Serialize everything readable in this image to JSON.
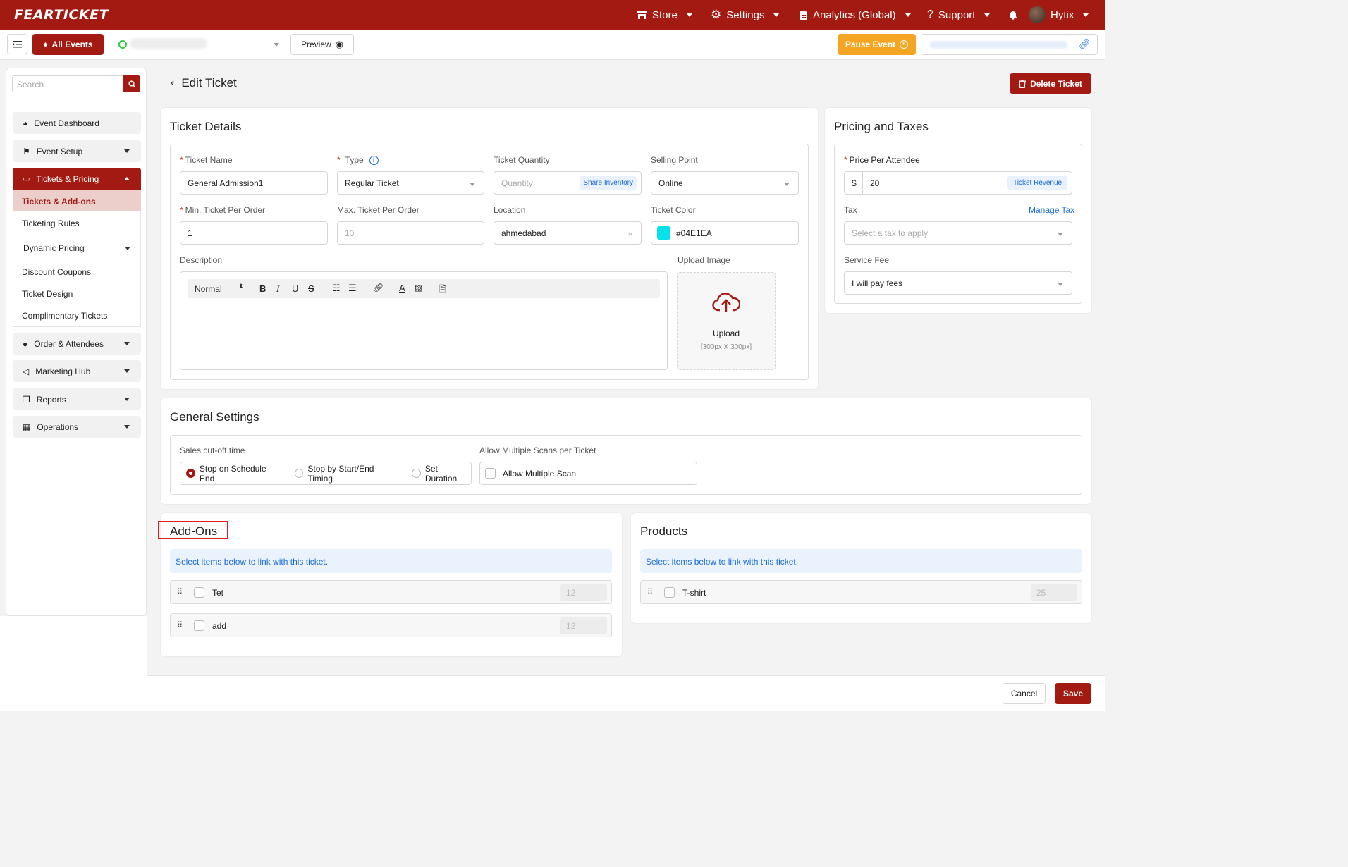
{
  "brand": {
    "logo_text": "FEARTICKET",
    "primary_color": "#a21a12",
    "accent_color": "#f4a622",
    "ticket_color_swatch": "#04E1EA"
  },
  "topnav": {
    "store": "Store",
    "settings": "Settings",
    "analytics": "Analytics (Global)",
    "support": "Support",
    "user": "Hytix"
  },
  "subbar": {
    "all_events": "All Events",
    "preview": "Preview",
    "pause_event": "Pause Event"
  },
  "sidebar": {
    "search_placeholder": "Search",
    "items": [
      {
        "label": "Event Dashboard",
        "icon": "dashboard-icon"
      },
      {
        "label": "Event Setup",
        "icon": "flag-icon"
      },
      {
        "label": "Tickets & Pricing",
        "icon": "ticket-icon"
      },
      {
        "label": "Order & Attendees",
        "icon": "person-icon"
      },
      {
        "label": "Marketing Hub",
        "icon": "megaphone-icon"
      },
      {
        "label": "Reports",
        "icon": "reports-icon"
      },
      {
        "label": "Operations",
        "icon": "grid-icon"
      }
    ],
    "subitems": [
      "Tickets & Add-ons",
      "Ticketing Rules",
      "Dynamic Pricing",
      "Discount Coupons",
      "Ticket Design",
      "Complimentary Tickets"
    ]
  },
  "page": {
    "title": "Edit Ticket",
    "delete_button": "Delete Ticket"
  },
  "ticket_details": {
    "title": "Ticket Details",
    "ticket_name_label": "Ticket Name",
    "ticket_name_value": "General Admission1",
    "type_label": "Type",
    "type_value": "Regular Ticket",
    "quantity_label": "Ticket Quantity",
    "quantity_placeholder": "Quantity",
    "share_inventory": "Share Inventory",
    "selling_point_label": "Selling Point",
    "selling_point_value": "Online",
    "min_label": "Min. Ticket Per Order",
    "min_value": "1",
    "max_label": "Max. Ticket Per Order",
    "max_placeholder": "10",
    "location_label": "Location",
    "location_value": "ahmedabad",
    "color_label": "Ticket Color",
    "color_value": "#04E1EA",
    "description_label": "Description",
    "editor_format": "Normal",
    "upload_label": "Upload Image",
    "upload_text": "Upload",
    "upload_hint": "[300px X 300px]"
  },
  "pricing": {
    "title": "Pricing and Taxes",
    "price_label": "Price Per Attendee",
    "currency": "$",
    "price_value": "20",
    "ticket_revenue": "Ticket Revenue",
    "tax_label": "Tax",
    "manage_tax": "Manage Tax",
    "tax_placeholder": "Select a tax to apply",
    "service_fee_label": "Service Fee",
    "service_fee_value": "I will pay fees"
  },
  "general_settings": {
    "title": "General Settings",
    "cutoff_label": "Sales cut-off time",
    "options": [
      "Stop on Schedule End",
      "Stop by Start/End Timing",
      "Set Duration"
    ],
    "multi_scan_label": "Allow Multiple Scans per Ticket",
    "multi_scan_option": "Allow Multiple Scan"
  },
  "addons": {
    "title": "Add-Ons",
    "info": "Select items below to link with this ticket.",
    "items": [
      {
        "name": "Tet",
        "qty": "12"
      },
      {
        "name": "add",
        "qty": "12"
      }
    ]
  },
  "products": {
    "title": "Products",
    "info": "Select items below to link with this ticket.",
    "items": [
      {
        "name": "T-shirt",
        "qty": "25"
      }
    ]
  },
  "footer": {
    "cancel": "Cancel",
    "save": "Save"
  }
}
